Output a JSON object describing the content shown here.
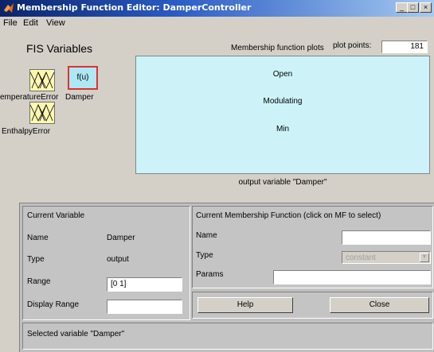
{
  "window": {
    "title": "Membership Function Editor: DamperController"
  },
  "menu": [
    "File",
    "Edit",
    "View"
  ],
  "fis": {
    "heading": "FIS Variables",
    "inputs": [
      {
        "name": "TemperatureError",
        "display": "emperatureError"
      },
      {
        "name": "EnthalpyError",
        "display": "EnthalpyError"
      }
    ],
    "output": {
      "name": "Damper",
      "box_text": "f(u)"
    }
  },
  "plot": {
    "header": "Membership function plots",
    "plot_points_label": "plot points:",
    "plot_points_value": "181",
    "mfs": [
      "Open",
      "Modulating",
      "Min"
    ],
    "caption": "output variable \"Damper\""
  },
  "current_variable": {
    "title": "Current Variable",
    "name_label": "Name",
    "name_value": "Damper",
    "type_label": "Type",
    "type_value": "output",
    "range_label": "Range",
    "range_value": "[0 1]",
    "display_range_label": "Display Range",
    "display_range_value": ""
  },
  "current_mf": {
    "title": "Current Membership Function (click on MF to select)",
    "name_label": "Name",
    "name_value": "",
    "type_label": "Type",
    "type_value": "constant",
    "params_label": "Params",
    "params_value": ""
  },
  "buttons": {
    "help": "Help",
    "close": "Close"
  },
  "status": "Selected variable \"Damper\""
}
